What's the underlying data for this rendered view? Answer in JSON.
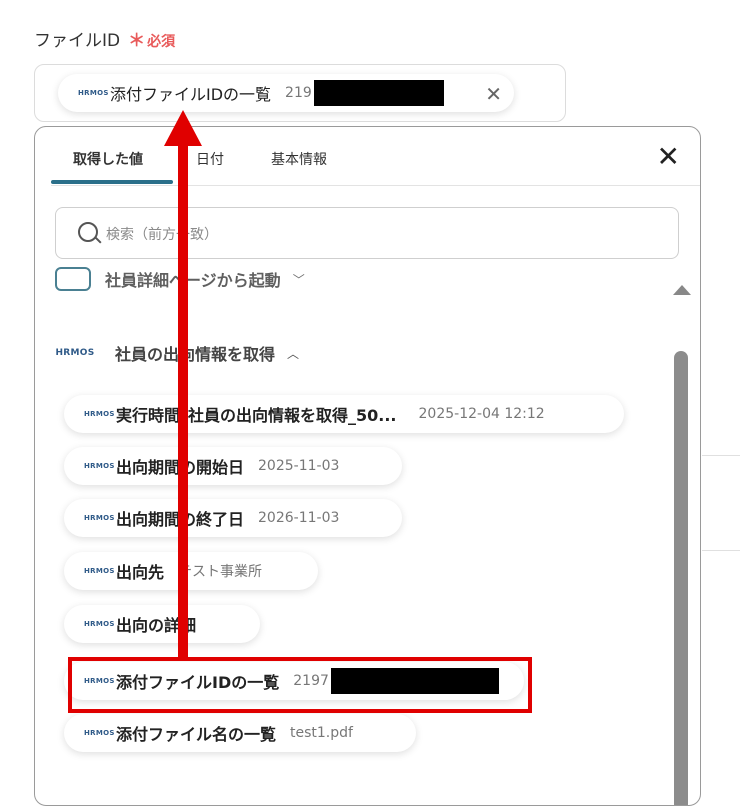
{
  "field": {
    "label": "ファイルID",
    "required_mark": "＊",
    "required_text": "必須"
  },
  "selected_chip": {
    "logo": "HRMOS",
    "label": "添付ファイルIDの一覧",
    "value": "219"
  },
  "panel": {
    "tabs": [
      "取得した値",
      "日付",
      "基本情報"
    ],
    "close_icon": "close-icon",
    "search_placeholder": "検索（前方一致）",
    "group_partial_label": "社員詳細ページから起動",
    "group": {
      "logo": "HRMOS",
      "label": "社員の出向情報を取得",
      "chevron": "︿"
    },
    "items": [
      {
        "label": "実行時間_社員の出向情報を取得_50...",
        "value": "2025-12-04 12:12"
      },
      {
        "label": "出向期間の開始日",
        "value": "2025-11-03"
      },
      {
        "label": "出向期間の終了日",
        "value": "2026-11-03"
      },
      {
        "label": "出向先",
        "value": "テスト事業所"
      },
      {
        "label": "出向の詳細",
        "value": ""
      },
      {
        "label": "添付ファイルIDの一覧",
        "value": "2197"
      },
      {
        "label": "添付ファイル名の一覧",
        "value": "test1.pdf"
      }
    ]
  },
  "colors": {
    "accent": "#2a6f8a",
    "required": "#e85a5a",
    "annotation": "#e00000"
  }
}
